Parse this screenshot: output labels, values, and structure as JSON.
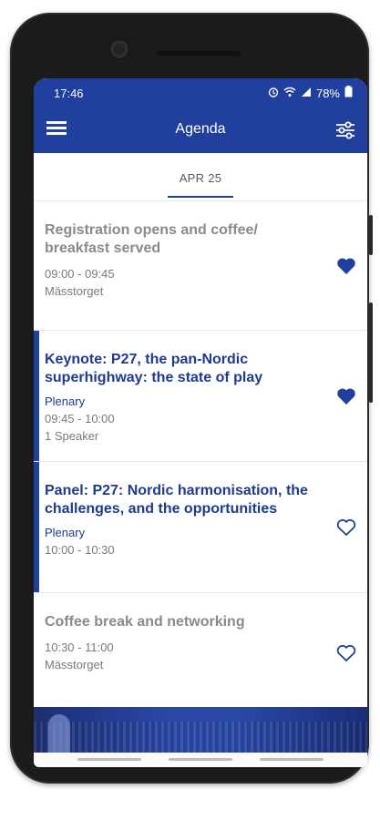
{
  "status_bar": {
    "time": "17:46",
    "battery": "78%"
  },
  "app_bar": {
    "title": "Agenda"
  },
  "date_tab": "APR 25",
  "sessions": [
    {
      "title": "Registration opens and coffee/ breakfast served",
      "time": "09:00 - 09:45",
      "location": "Mässtorget",
      "favorite": true,
      "active": false
    },
    {
      "title": "Keynote: P27, the pan-Nordic superhighway: the state of play",
      "track": "Plenary",
      "time": "09:45 - 10:00",
      "speakers": "1 Speaker",
      "favorite": true,
      "active": true
    },
    {
      "title": "Panel: P27: Nordic harmonisation, the challenges, and the opportunities",
      "track": "Plenary",
      "time": "10:00 - 10:30",
      "favorite": false,
      "active": true
    },
    {
      "title": "Coffee break and networking",
      "time": "10:30 - 11:00",
      "location": "Mässtorget",
      "favorite": false,
      "active": false
    }
  ],
  "colors": {
    "brand": "#213f9c",
    "active_title": "#1f3a8f",
    "inactive_title": "#8a8a8a"
  }
}
